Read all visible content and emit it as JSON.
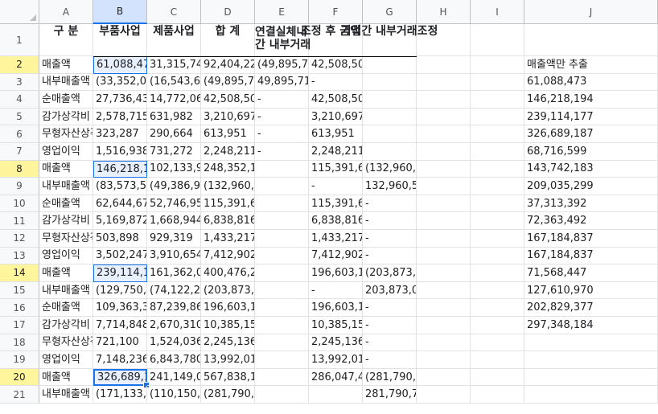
{
  "columns": [
    "A",
    "B",
    "C",
    "D",
    "E",
    "F",
    "G",
    "H",
    "I",
    "J"
  ],
  "rows": [
    {
      "num": "1",
      "a": "구 분",
      "b": "부품사업",
      "c": "제품사업",
      "d": "합 계",
      "e": "연결실체내\n간 내부거래",
      "f": "조정 후 금액",
      "g": "기업간 내부거래조정",
      "j": ""
    },
    {
      "num": "2",
      "a": "매출액",
      "b": "61,088,473",
      "c": "31,315,74",
      "d": "92,404,22",
      "e": "(49,895,71",
      "f": "42,508,505",
      "g": "",
      "j": "매출액만 추출"
    },
    {
      "num": "3",
      "a": "내부매출액",
      "b": "(33,352,0",
      "c": "(16,543,6",
      "d": "(49,895,71",
      "e": "49,895,71",
      "f": "-",
      "g": "",
      "j": "61,088,473"
    },
    {
      "num": "4",
      "a": "순매출액",
      "b": "27,736,43",
      "c": "14,772,06",
      "d": "42,508,50",
      "e": "-",
      "f": "42,508,505",
      "g": "",
      "j": "146,218,194"
    },
    {
      "num": "5",
      "a": "감가상각비",
      "b": "2,578,715",
      "c": "631,982",
      "d": "3,210,697",
      "e": "-",
      "f": "3,210,697",
      "g": "",
      "j": "239,114,177"
    },
    {
      "num": "6",
      "a": "무형자산상각비",
      "b": "323,287",
      "c": "290,664",
      "d": "613,951",
      "e": "-",
      "f": "613,951",
      "g": "",
      "j": "326,689,187"
    },
    {
      "num": "7",
      "a": "영업이익",
      "b": "1,516,938",
      "c": "731,272",
      "d": "2,248,211",
      "e": "-",
      "f": "2,248,211",
      "g": "",
      "j": "68,716,599"
    },
    {
      "num": "8",
      "a": "매출액",
      "b": "146,218,1",
      "c": "102,133,9",
      "d": "248,352,146",
      "e": "",
      "f": "115,391,6",
      "g": "(132,960,509)",
      "j": "143,742,183"
    },
    {
      "num": "9",
      "a": "내부매출액",
      "b": "(83,573,5",
      "c": "(49,386,9",
      "d": "(132,960,509)",
      "e": "",
      "f": "-",
      "g": "132,960,509",
      "j": "209,035,299"
    },
    {
      "num": "10",
      "a": "순매출액",
      "b": "62,644,67",
      "c": "52,746,95",
      "d": "115,391,637",
      "e": "",
      "f": "115,391,6",
      "g": "-",
      "j": "37,313,392"
    },
    {
      "num": "11",
      "a": "감가상각비",
      "b": "5,169,872",
      "c": "1,668,944",
      "d": "6,838,816",
      "e": "",
      "f": "6,838,816",
      "g": "-",
      "j": "72,363,492"
    },
    {
      "num": "12",
      "a": "무형자산상각비",
      "b": "503,898",
      "c": "929,319",
      "d": "1,433,217",
      "e": "",
      "f": "1,433,217",
      "g": "-",
      "j": "167,184,837"
    },
    {
      "num": "13",
      "a": "영업이익",
      "b": "3,502,247",
      "c": "3,910,654",
      "d": "7,412,902",
      "e": "",
      "f": "7,412,902",
      "g": "-",
      "j": "167,184,837"
    },
    {
      "num": "14",
      "a": "매출액",
      "b": "239,114,1",
      "c": "161,362,0",
      "d": "400,476,254",
      "e": "",
      "f": "196,603,1",
      "g": "(203,873,069)",
      "j": "71,568,447"
    },
    {
      "num": "15",
      "a": "내부매출액",
      "b": "(129,750,8",
      "c": "(74,122,2",
      "d": "(203,873,069)",
      "e": "",
      "f": "-",
      "g": "203,873,069",
      "j": "127,610,970"
    },
    {
      "num": "16",
      "a": "순매출액",
      "b": "109,363,3",
      "c": "87,239,86",
      "d": "196,603,185",
      "e": "",
      "f": "196,603,1",
      "g": "-",
      "j": "202,829,377"
    },
    {
      "num": "17",
      "a": "감가상각비",
      "b": "7,714,848",
      "c": "2,670,310",
      "d": "10,385,158",
      "e": "",
      "f": "10,385,15",
      "g": "-",
      "j": "297,348,184"
    },
    {
      "num": "18",
      "a": "무형자산상각비",
      "b": "721,100",
      "c": "1,524,036",
      "d": "2,245,136",
      "e": "",
      "f": "2,245,136",
      "g": "-",
      "j": ""
    },
    {
      "num": "19",
      "a": "영업이익",
      "b": "7,148,236",
      "c": "6,843,780",
      "d": "13,992,017",
      "e": "",
      "f": "13,992,01",
      "g": "-",
      "j": ""
    },
    {
      "num": "20",
      "a": "매출액",
      "b": "326,689,1",
      "c": "241,149,0",
      "d": "567,838,199",
      "e": "",
      "f": "286,047,4",
      "g": "(281,790,739)",
      "j": ""
    },
    {
      "num": "21",
      "a": "내부매출액",
      "b": "(171,133,",
      "c": "(110,150,",
      "d": "(281,790,739)",
      "e": "",
      "f": "",
      "g": "281,790,739",
      "j": ""
    }
  ],
  "highlighted_rows": [
    "2",
    "8",
    "14",
    "20"
  ],
  "selected_column": "B",
  "selected_cells_b": [
    "2",
    "8",
    "14",
    "20"
  ],
  "active_cell": "B20"
}
